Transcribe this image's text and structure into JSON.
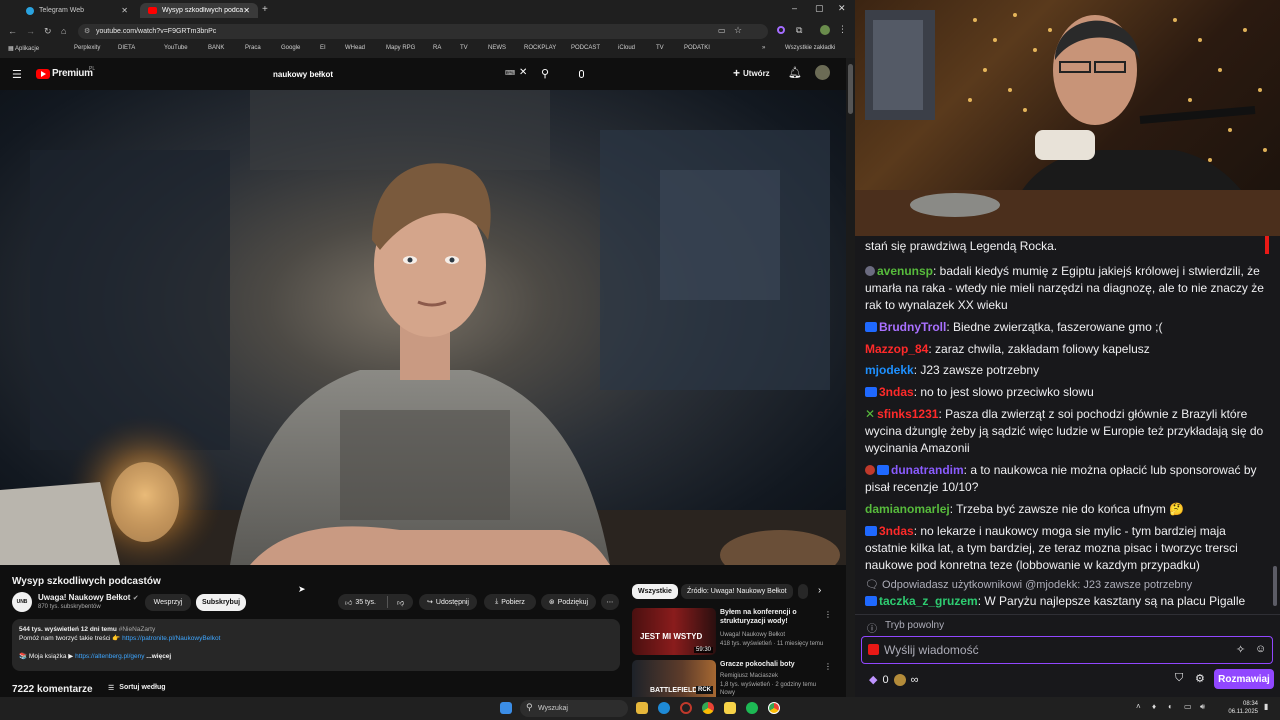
{
  "browser": {
    "tabs": [
      {
        "label": "Telegram Web"
      },
      {
        "label": "Wysyp szkodliwych podcastów"
      }
    ],
    "url": "youtube.com/watch?v=F9GRTm3bnPc",
    "bookmarks": [
      "Aplikacje",
      "Perplexity",
      "DIETA",
      "YouTube",
      "BANK",
      "Praca",
      "Google",
      "EI",
      "WHead",
      "Mapy RPG",
      "RA",
      "TV",
      "NEWS",
      "ROCKPLAY",
      "PODCAST",
      "iCloud",
      "TV",
      "PODATKI"
    ],
    "all_bookmarks": "Wszystkie zakładki"
  },
  "youtube": {
    "logo": "Premium",
    "logo_region": "PL",
    "search_value": "naukowy bełkot",
    "create_label": "Utwórz",
    "video_title": "Wysyp szkodliwych podcastów",
    "channel": {
      "avatar_text": "UNB",
      "name": "Uwaga! Naukowy Bełkot",
      "subscribers": "870 tys. subskrybentów",
      "support_label": "Wesprzyj",
      "subscribe_label": "Subskrybuj"
    },
    "actions": {
      "likes": "35 tys.",
      "share": "Udostępnij",
      "download": "Pobierz",
      "thanks": "Podziękuj"
    },
    "description": {
      "stats": "544 tys. wyświetleń  12 dni temu",
      "hashtag": "#NieNaZarty",
      "line1": "Pomóż nam tworzyć takie treści 👉",
      "line1_link": "https://patronite.pl/NaukowyBelkot",
      "line2": "📚 Moja książka ▶",
      "line2_link": "https://altenberg.pl/geny",
      "more": "...więcej"
    },
    "comments": {
      "count": "7222 komentarze",
      "sort": "Sortuj według"
    },
    "chips": [
      "Wszystkie",
      "Źródło: Uwaga! Naukowy Bełkot"
    ],
    "recommendations": [
      {
        "title": "Byłem na konferencji o strukturyzacji wody!",
        "channel": "Uwaga! Naukowy Bełkot",
        "meta": "418 tys. wyświetleń · 11 miesięcy temu",
        "thumb_text": "JEST MI WSTYD",
        "duration": "59:30"
      },
      {
        "title": "Gracze pokochali boty",
        "channel": "Remigiusz Maciaszek",
        "meta": "1,8 tys. wyświetleń · 2 godziny temu",
        "thumb_text": "BATTLEFIELD 6",
        "badge": "RCK",
        "extra": "Nowy"
      }
    ]
  },
  "chat": {
    "messages": [
      {
        "user": "",
        "user_color": "#efeff1",
        "text": "stań się prawdziwą Legendą Rocka."
      },
      {
        "user": "avenunsp",
        "user_color": "#57bb3c",
        "text": ": badali kiedyś mumię z Egiptu jakiejś królowej i stwierdzili, że umarła na raka - wtedy nie mieli narzędzi na diagnozę, ale to nie znaczy że rak to wynalazek XX wieku"
      },
      {
        "user": "BrudnyTroll",
        "user_color": "#a970ff",
        "text": ": Biedne zwierzątka, faszerowane gmo ;("
      },
      {
        "user": "Mazzop_84",
        "user_color": "#ff2a2a",
        "text": ": zaraz chwila, zakładam foliowy kapelusz"
      },
      {
        "user": "mjodekk",
        "user_color": "#1e90ff",
        "text": ": J23 zawsze potrzebny"
      },
      {
        "user": "3ndas",
        "user_color": "#ff2a2a",
        "text": ": no to jest slowo przeciwko slowu"
      },
      {
        "user": "sfinks1231",
        "user_color": "#ff2a2a",
        "text": ": Pasza dla zwierząt z soi pochodzi głównie z Brazyli które wycina dżunglę żeby ją sądzić więc ludzie w Europie też przykładają się do wycinania Amazonii"
      },
      {
        "user": "dunatrandim",
        "user_color": "#8a5cff",
        "text": ": a to naukowca nie można opłacić lub sponsorować by pisał recenzje 10/10?"
      },
      {
        "user": "damianomarlej",
        "user_color": "#57bb3c",
        "text": ": Trzeba być zawsze nie do końca ufnym 🤔"
      },
      {
        "user": "3ndas",
        "user_color": "#ff2a2a",
        "text": ": no lekarze i naukowcy moga sie mylic - tym bardziej maja ostatnie kilka lat, a tym bardziej, ze teraz mozna pisac i tworzyc trersci naukowe pod konretna teze (lobbowanie w kazdym przypadku)"
      },
      {
        "user": "taczka_z_gruzem",
        "user_color": "#2ecc71",
        "text": ": W Paryżu najlepsze kasztany są na placu Pigalle"
      }
    ],
    "reply_hint": "Odpowiadasz użytkownikowi @mjodekk: J23 zawsze potrzebny",
    "slow_mode": "Tryb powolny",
    "input_placeholder": "Wyślij wiadomość",
    "points": "0",
    "send_label": "Rozmawiaj"
  },
  "taskbar": {
    "search": "Wyszukaj",
    "time": "08:34",
    "date": "06.11.2025"
  }
}
